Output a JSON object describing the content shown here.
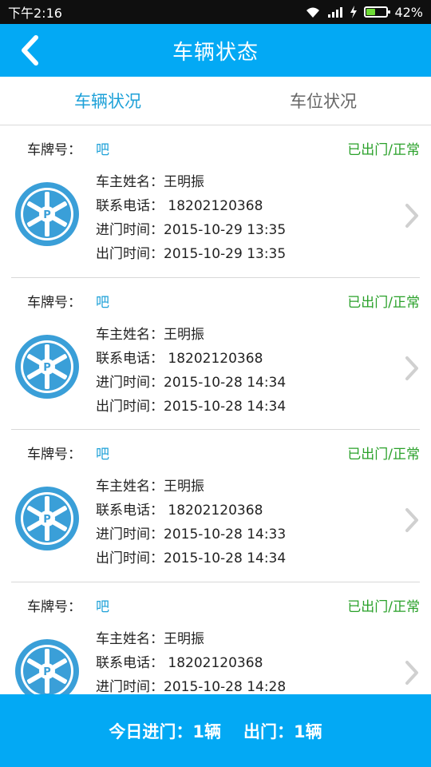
{
  "status_bar": {
    "time": "下午2:16",
    "battery": "42%",
    "battery_level": 0.42,
    "icons": [
      "wifi-icon",
      "signal-icon",
      "charging-icon",
      "battery-icon"
    ]
  },
  "header": {
    "title": "车辆状态",
    "back_icon": "chevron-left-icon"
  },
  "tabs": [
    {
      "label": "车辆状况",
      "active": true
    },
    {
      "label": "车位状况",
      "active": false
    }
  ],
  "labels": {
    "plate": "车牌号：",
    "owner": "车主姓名：",
    "phone": "联系电话：",
    "enter": "进门时间：",
    "exit": "出门时间："
  },
  "records": [
    {
      "plate": "吧",
      "status": "已出门/正常",
      "owner": "王明振",
      "phone": "18202120368",
      "enter_time": "2015-10-29 13:35",
      "exit_time": "2015-10-29 13:35"
    },
    {
      "plate": "吧",
      "status": "已出门/正常",
      "owner": "王明振",
      "phone": "18202120368",
      "enter_time": "2015-10-28 14:34",
      "exit_time": "2015-10-28 14:34"
    },
    {
      "plate": "吧",
      "status": "已出门/正常",
      "owner": "王明振",
      "phone": "18202120368",
      "enter_time": "2015-10-28 14:33",
      "exit_time": "2015-10-28 14:34"
    },
    {
      "plate": "吧",
      "status": "已出门/正常",
      "owner": "王明振",
      "phone": "18202120368",
      "enter_time": "2015-10-28 14:28",
      "exit_time": ""
    }
  ],
  "footer": {
    "today_enter": "今日进门：1辆",
    "exit": "出门：1辆"
  },
  "colors": {
    "primary": "#03a9f4",
    "accent_text": "#1ea1d8",
    "status_ok": "#2aa12a"
  }
}
